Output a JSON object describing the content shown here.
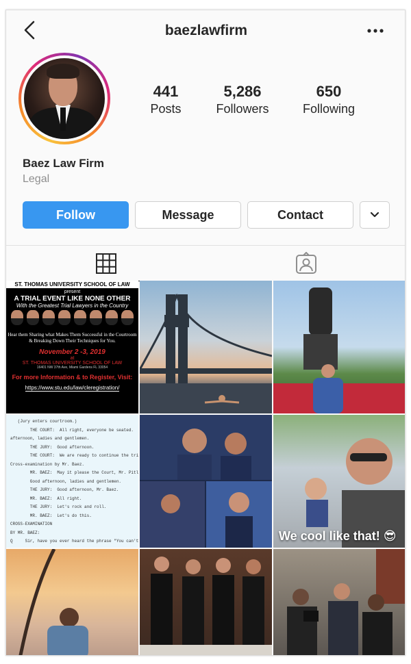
{
  "header": {
    "username": "baezlawfirm"
  },
  "profile": {
    "stats": [
      {
        "value": "441",
        "label": "Posts"
      },
      {
        "value": "5,286",
        "label": "Followers"
      },
      {
        "value": "650",
        "label": "Following"
      }
    ],
    "name": "Baez Law Firm",
    "category": "Legal"
  },
  "actions": {
    "follow": "Follow",
    "message": "Message",
    "contact": "Contact"
  },
  "tabs": [
    "grid-icon",
    "tagged-icon"
  ],
  "colors": {
    "follow_button": "#3897f0",
    "background": "#fafafa",
    "muted_text": "#8e8e8e"
  },
  "posts": {
    "flyer": {
      "school": "ST. THOMAS UNIVERSITY SCHOOL OF LAW",
      "presents": "present",
      "headline": "A TRIAL EVENT LIKE NONE OTHER",
      "subhead": "With the Greatest Trial Lawyers in the Country",
      "body": "Hear them Sharing what Makes Them Successful in the Courtroom & Breaking Down Their Techniques for You.",
      "date": "November 2 -3, 2019",
      "at": "at",
      "venue": "ST. THOMAS UNIVERSITY SCHOOL OF LAW",
      "address": "16401 NW 37th Ave, Miami Gardens FL 33054",
      "register": "For more Information & to Register, Visit:",
      "url": "https://www.stu.edu/law/cleregistration/"
    },
    "transcript": "   (Jury enters courtroom.)\n        THE COURT:  All right, everyone be seated.  Good\nafternoon, ladies and gentlemen.\n        THE JURY:  Good afternoon.\n        THE COURT:  We are ready to continue the trial.\nCross-examination by Mr. Baez.\n        MR. BAEZ:  May it please the Court, Mr. Pitlock.\n        Good afternoon, ladies and gentlemen.\n        THE JURY:  Good afternoon, Mr. Baez.\n        MR. BAEZ:  All right.\n        THE JURY:  Let's rock and roll.\n        MR. BAEZ:  Let's do this.\nCROSS-EXAMINATION\nBY MR. BAEZ:\nQ     Sir, have you ever heard the phrase \"You can't trust t\nmessage if you can't trust the messenger?\"",
    "convertible_caption": "We cool like that! 😎"
  }
}
